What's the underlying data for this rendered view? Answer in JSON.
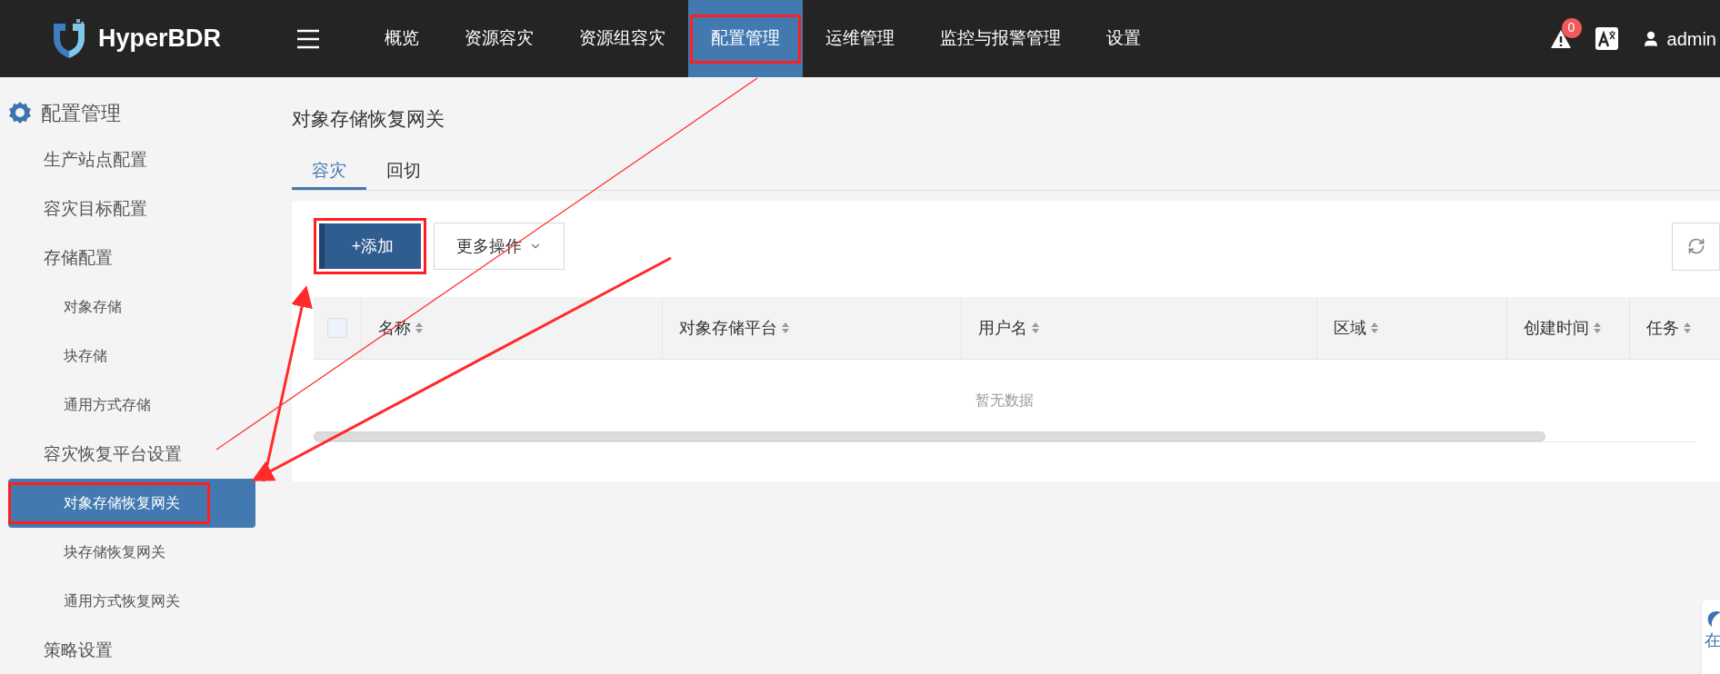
{
  "header": {
    "logo": "HyperBDR",
    "nav": [
      {
        "label": "概览",
        "selected": false,
        "highlighted": false
      },
      {
        "label": "资源容灾",
        "selected": false,
        "highlighted": false
      },
      {
        "label": "资源组容灾",
        "selected": false,
        "highlighted": false
      },
      {
        "label": "配置管理",
        "selected": true,
        "highlighted": true
      },
      {
        "label": "运维管理",
        "selected": false,
        "highlighted": false
      },
      {
        "label": "监控与报警管理",
        "selected": false,
        "highlighted": false
      },
      {
        "label": "设置",
        "selected": false,
        "highlighted": false
      }
    ],
    "alert_count": "0",
    "user": "admin"
  },
  "sidebar": {
    "title": "配置管理",
    "items": [
      {
        "label": "生产站点配置",
        "selected": false,
        "highlighted": false
      },
      {
        "label": "容灾目标配置",
        "selected": false,
        "highlighted": false
      },
      {
        "label": "存储配置",
        "selected": false,
        "highlighted": false,
        "children": [
          {
            "label": "对象存储",
            "selected": false,
            "highlighted": false
          },
          {
            "label": "块存储",
            "selected": false,
            "highlighted": false
          },
          {
            "label": "通用方式存储",
            "selected": false,
            "highlighted": false
          }
        ]
      },
      {
        "label": "容灾恢复平台设置",
        "selected": false,
        "highlighted": false,
        "children": [
          {
            "label": "对象存储恢复网关",
            "selected": true,
            "highlighted": true
          },
          {
            "label": "块存储恢复网关",
            "selected": false,
            "highlighted": false
          },
          {
            "label": "通用方式恢复网关",
            "selected": false,
            "highlighted": false
          }
        ]
      },
      {
        "label": "策略设置",
        "selected": false,
        "highlighted": false
      }
    ]
  },
  "page": {
    "title": "对象存储恢复网关",
    "tabs": [
      {
        "label": "容灾",
        "selected": true
      },
      {
        "label": "回切",
        "selected": false
      }
    ],
    "add_button": {
      "label": "+添加",
      "highlighted": true
    },
    "more_button": "更多操作",
    "table": {
      "select_all": {
        "checked": false
      },
      "columns": [
        "名称",
        "对象存储平台",
        "用户名",
        "区域",
        "创建时间",
        "任务"
      ],
      "empty_text": "暂无数据"
    }
  },
  "help_widget": {
    "label": "在"
  }
}
